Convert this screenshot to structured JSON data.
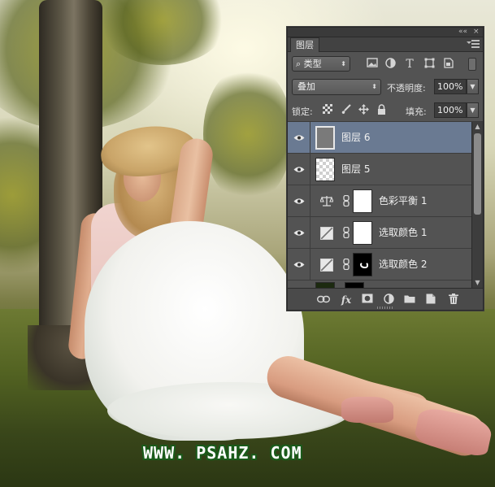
{
  "watermark": "WWW. PSAHZ. COM",
  "panel": {
    "tab_label": "图层",
    "topbar_collapse": "««",
    "topbar_close": "×",
    "filter": {
      "kind_label": "类型",
      "icons": [
        "image-filter-icon",
        "adjustment-filter-icon",
        "type-filter-icon",
        "shape-filter-icon",
        "smart-object-filter-icon"
      ]
    },
    "blend_mode": "叠加",
    "opacity_label": "不透明度:",
    "opacity_value": "100%",
    "lock_label": "锁定:",
    "fill_label": "填充:",
    "fill_value": "100%",
    "layers": [
      {
        "name": "图层 6",
        "thumb": "gray",
        "selected": true
      },
      {
        "name": "图层 5",
        "thumb": "checker",
        "selected": false
      },
      {
        "name": "色彩平衡 1",
        "thumb": "white",
        "adjustment": "balance-scale-icon",
        "selected": false
      },
      {
        "name": "选取颜色 1",
        "thumb": "white",
        "adjustment": "selective-color-icon",
        "selected": false
      },
      {
        "name": "选取颜色 2",
        "thumb": "black",
        "adjustment": "selective-color-icon",
        "selected": false
      }
    ],
    "bottom_icons": [
      "link-layers-icon",
      "fx-icon",
      "add-mask-icon",
      "new-adjustment-icon",
      "new-group-icon",
      "new-layer-icon",
      "delete-layer-icon"
    ],
    "fx_label": "fx"
  },
  "colors": {
    "panel_bg": "#535353",
    "selected_row": "#6a7a92",
    "watermark_outline": "#1a5a1a"
  }
}
